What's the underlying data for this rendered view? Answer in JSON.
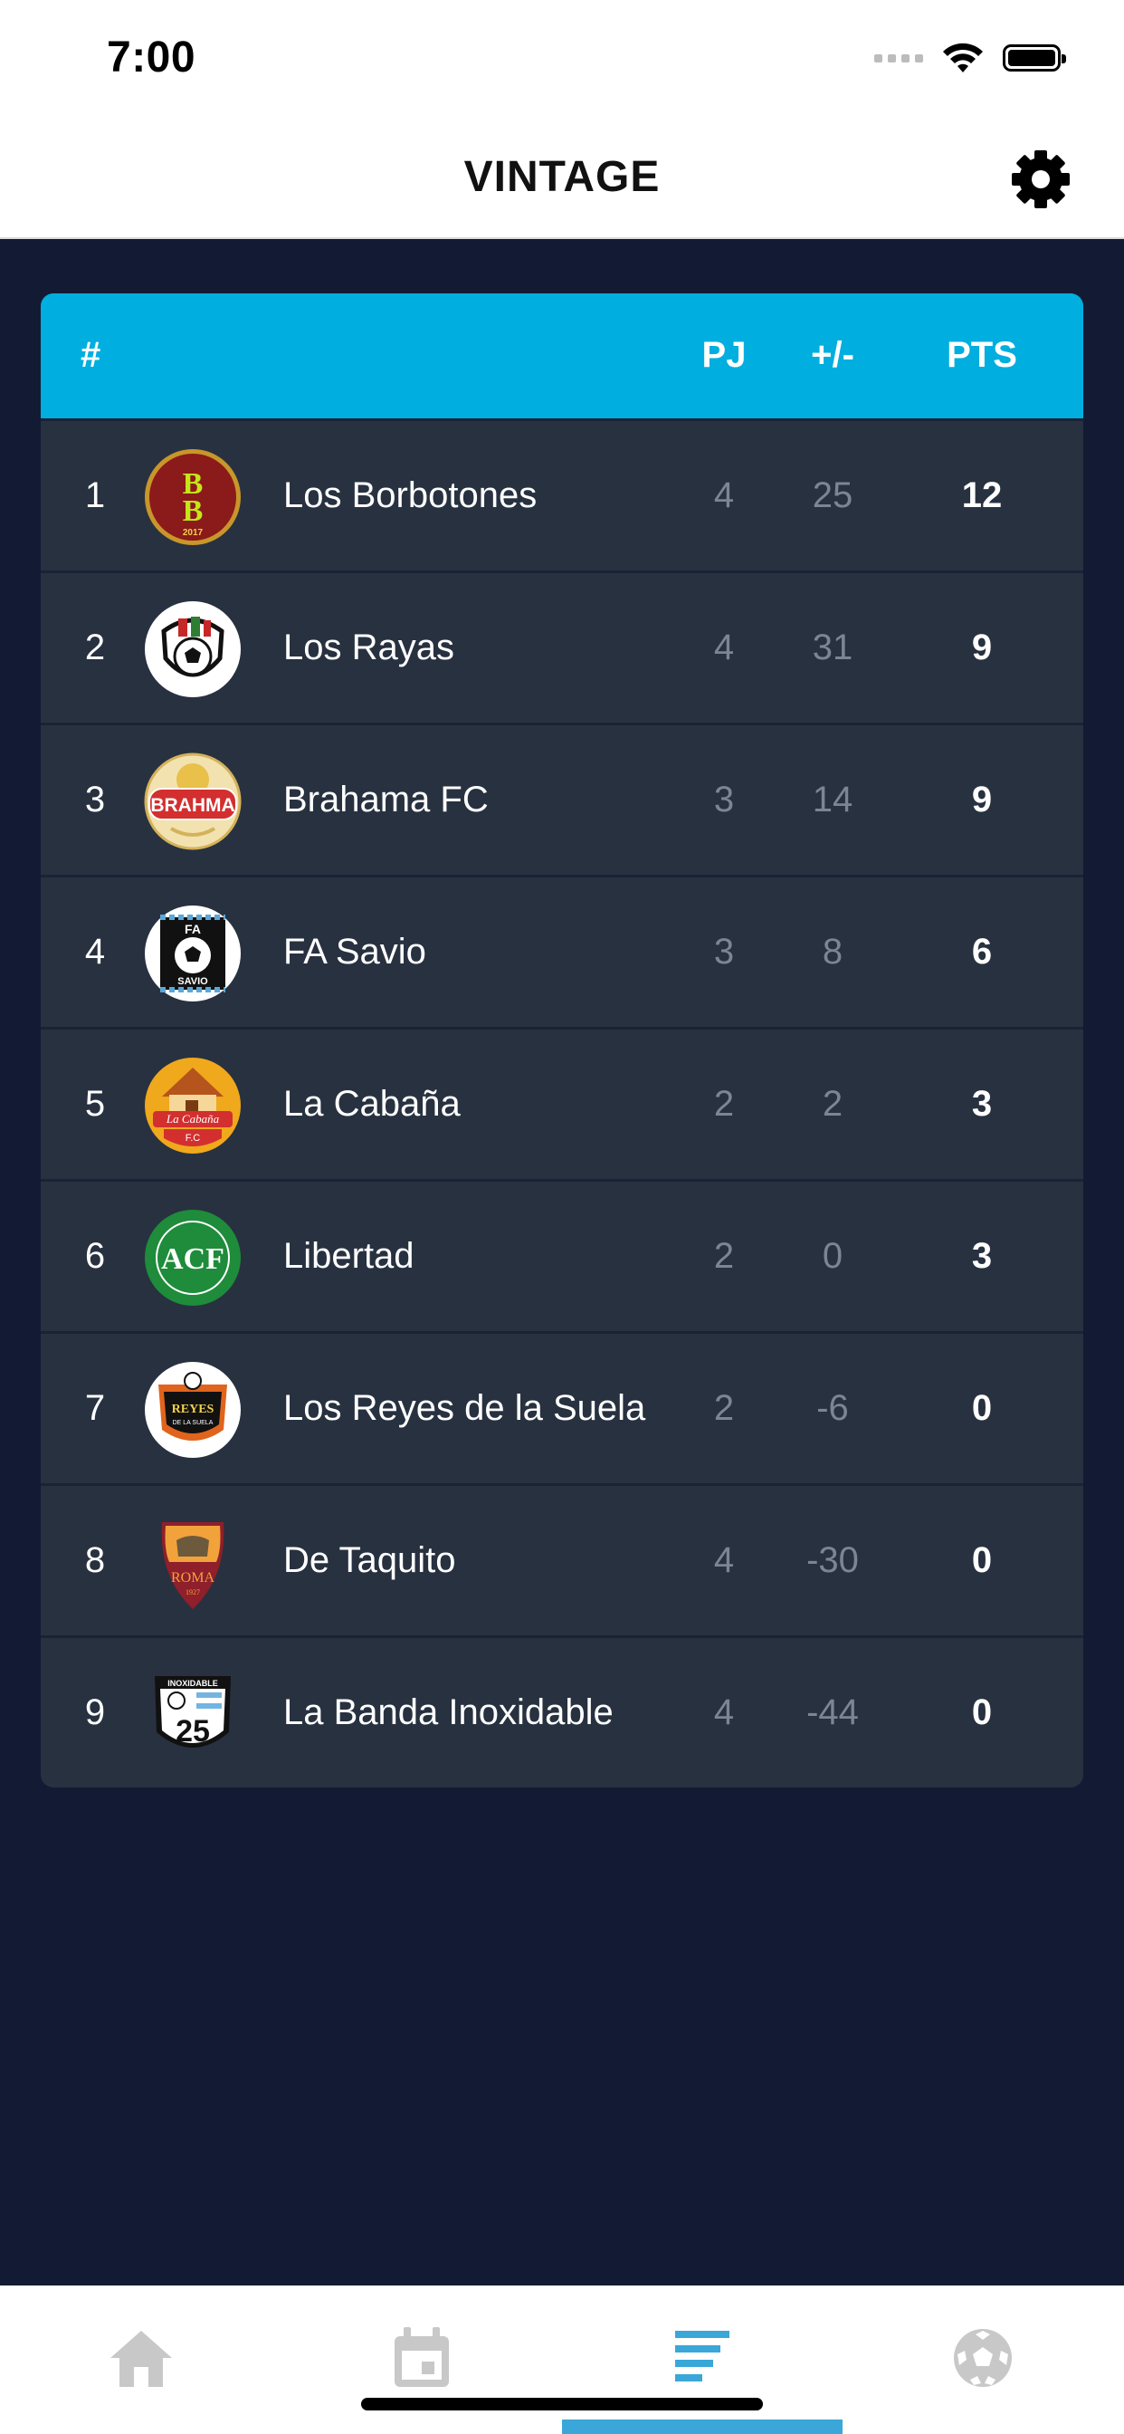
{
  "status_bar": {
    "time": "7:00"
  },
  "nav": {
    "title": "VINTAGE"
  },
  "table": {
    "headers": {
      "rank": "#",
      "played": "PJ",
      "diff": "+/-",
      "points": "PTS"
    },
    "rows": [
      {
        "pos": "1",
        "team": "Los Borbotones",
        "pj": "4",
        "diff": "25",
        "pts": "12"
      },
      {
        "pos": "2",
        "team": "Los Rayas",
        "pj": "4",
        "diff": "31",
        "pts": "9"
      },
      {
        "pos": "3",
        "team": "Brahama FC",
        "pj": "3",
        "diff": "14",
        "pts": "9"
      },
      {
        "pos": "4",
        "team": "FA Savio",
        "pj": "3",
        "diff": "8",
        "pts": "6"
      },
      {
        "pos": "5",
        "team": "La Cabaña",
        "pj": "2",
        "diff": "2",
        "pts": "3"
      },
      {
        "pos": "6",
        "team": "Libertad",
        "pj": "2",
        "diff": "0",
        "pts": "3"
      },
      {
        "pos": "7",
        "team": "Los Reyes de la Suela",
        "pj": "2",
        "diff": "-6",
        "pts": "0"
      },
      {
        "pos": "8",
        "team": "De Taquito",
        "pj": "4",
        "diff": "-30",
        "pts": "0"
      },
      {
        "pos": "9",
        "team": "La Banda Inoxidable",
        "pj": "4",
        "diff": "-44",
        "pts": "0"
      }
    ]
  },
  "logos": {
    "bb_line1": "B",
    "bb_line2": "B",
    "bb_year": "2017",
    "brahma": "BRAHMA",
    "savio_top": "FA",
    "savio_bottom": "SAVIO",
    "cabana": "La Cabaña",
    "cabana_fc": "F.C",
    "libertad": "ACF",
    "reyes": "REYES",
    "reyes_sub": "DE LA SUELA",
    "roma": "ROMA",
    "roma_year": "1927",
    "inox_top": "INOXIDABLE",
    "inox_num": "25"
  },
  "tab_bar": {
    "tabs": [
      "home-icon",
      "calendar-icon",
      "standings-icon",
      "soccer-ball-icon"
    ],
    "active": "standings-icon"
  },
  "colors": {
    "accent": "#00aedf",
    "background": "#121b33",
    "row": "#283140",
    "active_tab": "#3aa7d8",
    "inactive_tab": "#c8c8c8"
  }
}
